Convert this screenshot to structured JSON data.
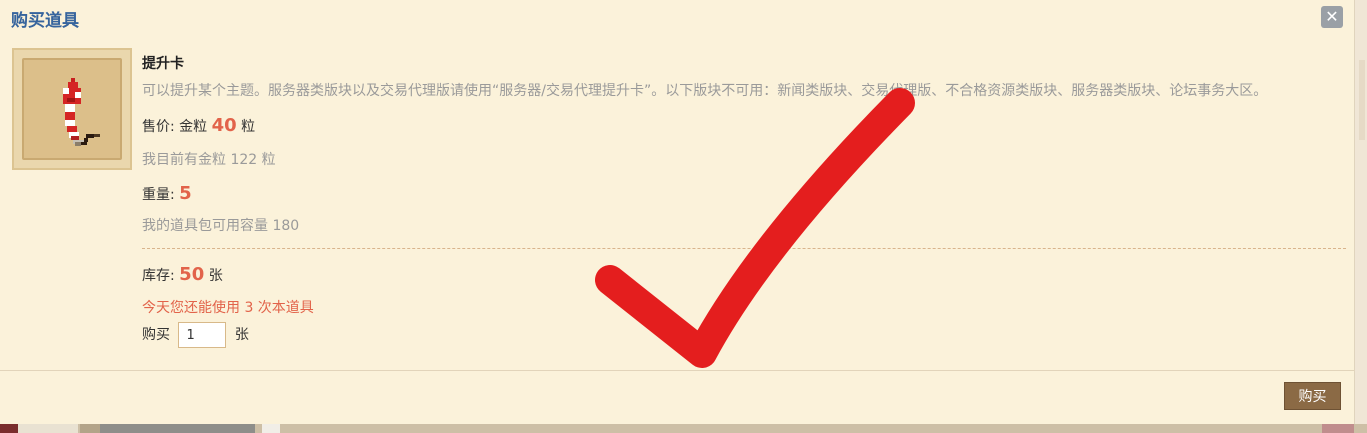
{
  "dialog": {
    "title": "购买道具",
    "close_glyph": "✕"
  },
  "item": {
    "icon": "firecracker-icon",
    "name": "提升卡",
    "description": "可以提升某个主题。服务器类版块以及交易代理版请使用“服务器/交易代理提升卡”。以下版块不可用：新闻类版块、交易代理版、不合格资源类版块、服务器类版块、论坛事务大区。"
  },
  "price": {
    "label": "售价:",
    "currency": "金粒",
    "value": "40",
    "unit": "粒",
    "balance_text": "我目前有金粒 122 粒"
  },
  "weight": {
    "label": "重量:",
    "value": "5",
    "capacity_text": "我的道具包可用容量 180"
  },
  "stock": {
    "label": "库存:",
    "value": "50",
    "unit": "张",
    "usage_note": "今天您还能使用 3 次本道具"
  },
  "purchase": {
    "label": "购买",
    "quantity": "1",
    "unit": "张",
    "button_label": "购买"
  },
  "colors": {
    "title": "#36649d",
    "accent": "#e2634a",
    "button": "#8b6a45",
    "checkmark": "#e41e1e"
  }
}
